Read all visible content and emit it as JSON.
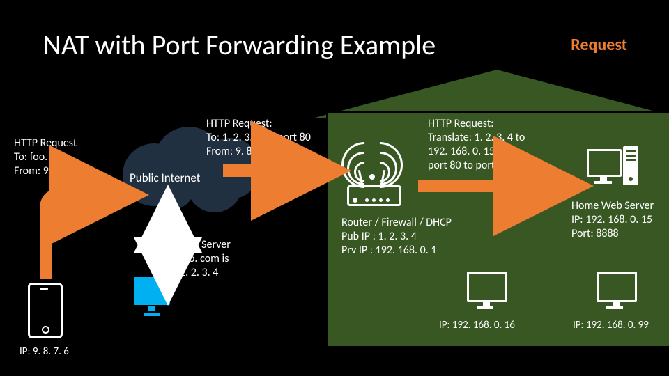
{
  "title": "NAT with Port Forwarding Example",
  "subtitle": "Request",
  "phone": {
    "ip_label": "IP: 9. 8. 7. 6"
  },
  "req1": {
    "l1": "HTTP Request",
    "l2": "To: foo. com",
    "l3": "From: 9. 8. 7. 6"
  },
  "cloud_label": "Public Internet",
  "dns": {
    "l1": "DNS Server",
    "l2": "foo. com is",
    "l3": "1. 2. 3. 4"
  },
  "req2": {
    "l1": "HTTP Request:",
    "l2": "To: 1. 2. 3. 4 on port 80",
    "l3": "From: 9. 8. 7. 6"
  },
  "req3": {
    "l1": "HTTP Request:",
    "l2": "Translate: 1. 2. 3. 4 to",
    "l3": "192. 168. 0. 15",
    "l4": "port 80 to port 8888"
  },
  "router": {
    "l1": "Router / Firewall / DHCP",
    "l2": "Pub IP : 1. 2. 3. 4",
    "l3": "Prv IP  : 192. 168. 0. 1"
  },
  "server": {
    "l1": "Home Web Server",
    "l2": "IP:  192. 168. 0. 15",
    "l3": "Port: 8888"
  },
  "lan_pc1": {
    "ip": "IP:  192. 168. 0. 16"
  },
  "lan_pc2": {
    "ip": "IP:  192. 168. 0. 99"
  },
  "colors": {
    "accent": "#ed7d31",
    "house": "#385723"
  }
}
